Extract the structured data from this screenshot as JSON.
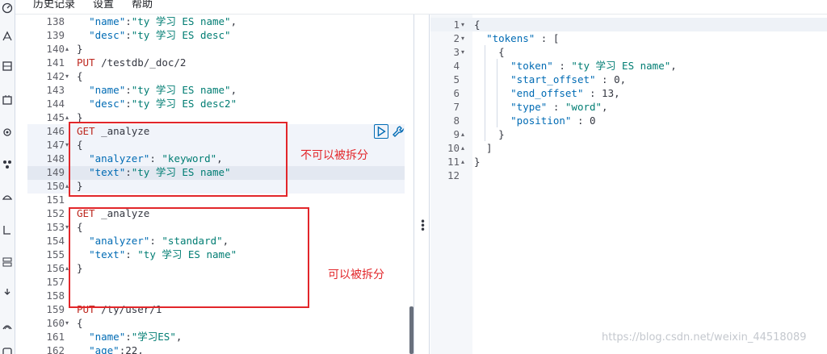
{
  "menu": {
    "history": "历史记录",
    "settings": "设置",
    "help": "帮助"
  },
  "sidebar_icons": [
    "dashboard-icon",
    "discover-icon",
    "visualize-icon",
    "canvas-icon",
    "maps-icon",
    "ml-icon",
    "infrastructure-icon",
    "logs-icon",
    "apm-icon",
    "uptime-icon",
    "devtools-icon",
    "monitoring-icon"
  ],
  "request_lines": [
    {
      "n": "138",
      "fold": "",
      "segs": [
        [
          "  ",
          "p"
        ],
        [
          "\"name\"",
          "k"
        ],
        [
          ":",
          "p"
        ],
        [
          "\"ty 学习 ES name\"",
          "s"
        ],
        [
          ",",
          "p"
        ]
      ]
    },
    {
      "n": "139",
      "fold": "",
      "segs": [
        [
          "  ",
          "p"
        ],
        [
          "\"desc\"",
          "k"
        ],
        [
          ":",
          "p"
        ],
        [
          "\"ty 学习 ES desc\"",
          "s"
        ]
      ]
    },
    {
      "n": "140",
      "fold": "▴",
      "segs": [
        [
          "}",
          "p"
        ]
      ]
    },
    {
      "n": "141",
      "fold": "",
      "segs": [
        [
          "PUT",
          "m"
        ],
        [
          " /testdb/_doc/2",
          "u"
        ]
      ]
    },
    {
      "n": "142",
      "fold": "▾",
      "segs": [
        [
          "{",
          "p"
        ]
      ]
    },
    {
      "n": "143",
      "fold": "",
      "segs": [
        [
          "  ",
          "p"
        ],
        [
          "\"name\"",
          "k"
        ],
        [
          ":",
          "p"
        ],
        [
          "\"ty 学习 ES name\"",
          "s"
        ],
        [
          ",",
          "p"
        ]
      ]
    },
    {
      "n": "144",
      "fold": "",
      "segs": [
        [
          "  ",
          "p"
        ],
        [
          "\"desc\"",
          "k"
        ],
        [
          ":",
          "p"
        ],
        [
          "\"ty 学习 ES desc2\"",
          "s"
        ]
      ]
    },
    {
      "n": "145",
      "fold": "▴",
      "segs": [
        [
          "}",
          "p"
        ]
      ]
    },
    {
      "n": "146",
      "fold": "",
      "segs": [
        [
          "GET",
          "m"
        ],
        [
          " _analyze",
          "u"
        ]
      ]
    },
    {
      "n": "147",
      "fold": "▾",
      "segs": [
        [
          "{",
          "p"
        ]
      ]
    },
    {
      "n": "148",
      "fold": "",
      "segs": [
        [
          "  ",
          "p"
        ],
        [
          "\"analyzer\"",
          "k"
        ],
        [
          ": ",
          "p"
        ],
        [
          "\"keyword\"",
          "s"
        ],
        [
          ",",
          "p"
        ]
      ]
    },
    {
      "n": "149",
      "fold": "",
      "segs": [
        [
          "  ",
          "p"
        ],
        [
          "\"text\"",
          "k"
        ],
        [
          ":",
          "p"
        ],
        [
          "\"ty 学习 ES name\"",
          "s"
        ]
      ]
    },
    {
      "n": "150",
      "fold": "▴",
      "segs": [
        [
          "}",
          "p"
        ]
      ]
    },
    {
      "n": "151",
      "fold": "",
      "segs": []
    },
    {
      "n": "152",
      "fold": "",
      "segs": [
        [
          "GET",
          "m"
        ],
        [
          " _analyze",
          "u"
        ]
      ]
    },
    {
      "n": "153",
      "fold": "▾",
      "segs": [
        [
          "{",
          "p"
        ]
      ]
    },
    {
      "n": "154",
      "fold": "",
      "segs": [
        [
          "  ",
          "p"
        ],
        [
          "\"analyzer\"",
          "k"
        ],
        [
          ": ",
          "p"
        ],
        [
          "\"standard\"",
          "s"
        ],
        [
          ",",
          "p"
        ]
      ]
    },
    {
      "n": "155",
      "fold": "",
      "segs": [
        [
          "  ",
          "p"
        ],
        [
          "\"text\"",
          "k"
        ],
        [
          ": ",
          "p"
        ],
        [
          "\"ty 学习 ES name\"",
          "s"
        ]
      ]
    },
    {
      "n": "156",
      "fold": "▴",
      "segs": [
        [
          "}",
          "p"
        ]
      ]
    },
    {
      "n": "157",
      "fold": "",
      "segs": []
    },
    {
      "n": "158",
      "fold": "",
      "segs": []
    },
    {
      "n": "159",
      "fold": "",
      "segs": [
        [
          "PUT",
          "m"
        ],
        [
          " /ty/user/1",
          "u"
        ]
      ]
    },
    {
      "n": "160",
      "fold": "▾",
      "segs": [
        [
          "{",
          "p"
        ]
      ]
    },
    {
      "n": "161",
      "fold": "",
      "segs": [
        [
          "  ",
          "p"
        ],
        [
          "\"name\"",
          "k"
        ],
        [
          ":",
          "p"
        ],
        [
          "\"学习ES\"",
          "s"
        ],
        [
          ",",
          "p"
        ]
      ]
    },
    {
      "n": "162",
      "fold": "",
      "segs": [
        [
          "  ",
          "p"
        ],
        [
          "\"age\"",
          "k"
        ],
        [
          ":",
          "p"
        ],
        [
          "22",
          "n"
        ],
        [
          ",",
          "p"
        ]
      ]
    }
  ],
  "response_lines": [
    {
      "n": "1",
      "fold": "▾",
      "segs": [
        [
          "{",
          "p"
        ]
      ]
    },
    {
      "n": "2",
      "fold": "▾",
      "segs": [
        [
          "  ",
          "p"
        ],
        [
          "\"tokens\"",
          "k"
        ],
        [
          " : [",
          "p"
        ]
      ]
    },
    {
      "n": "3",
      "fold": "▾",
      "segs": [
        [
          "    {",
          "p"
        ]
      ]
    },
    {
      "n": "4",
      "fold": "",
      "segs": [
        [
          "      ",
          "p"
        ],
        [
          "\"token\"",
          "k"
        ],
        [
          " : ",
          "p"
        ],
        [
          "\"ty 学习 ES name\"",
          "s"
        ],
        [
          ",",
          "p"
        ]
      ]
    },
    {
      "n": "5",
      "fold": "",
      "segs": [
        [
          "      ",
          "p"
        ],
        [
          "\"start_offset\"",
          "k"
        ],
        [
          " : ",
          "p"
        ],
        [
          "0",
          "n"
        ],
        [
          ",",
          "p"
        ]
      ]
    },
    {
      "n": "6",
      "fold": "",
      "segs": [
        [
          "      ",
          "p"
        ],
        [
          "\"end_offset\"",
          "k"
        ],
        [
          " : ",
          "p"
        ],
        [
          "13",
          "n"
        ],
        [
          ",",
          "p"
        ]
      ]
    },
    {
      "n": "7",
      "fold": "",
      "segs": [
        [
          "      ",
          "p"
        ],
        [
          "\"type\"",
          "k"
        ],
        [
          " : ",
          "p"
        ],
        [
          "\"word\"",
          "s"
        ],
        [
          ",",
          "p"
        ]
      ]
    },
    {
      "n": "8",
      "fold": "",
      "segs": [
        [
          "      ",
          "p"
        ],
        [
          "\"position\"",
          "k"
        ],
        [
          " : ",
          "p"
        ],
        [
          "0",
          "n"
        ]
      ]
    },
    {
      "n": "9",
      "fold": "▴",
      "segs": [
        [
          "    }",
          "p"
        ]
      ]
    },
    {
      "n": "10",
      "fold": "▴",
      "segs": [
        [
          "  ]",
          "p"
        ]
      ]
    },
    {
      "n": "11",
      "fold": "▴",
      "segs": [
        [
          "}",
          "p"
        ]
      ]
    },
    {
      "n": "12",
      "fold": "",
      "segs": []
    }
  ],
  "annotations": {
    "not_split": "不可以被拆分",
    "split": "可以被拆分"
  },
  "watermark": "https://blog.csdn.net/weixin_44518089",
  "colors": {
    "key": "#006bb4",
    "string": "#017d73",
    "method": "#bd271e",
    "annotation": "#e2262a"
  }
}
